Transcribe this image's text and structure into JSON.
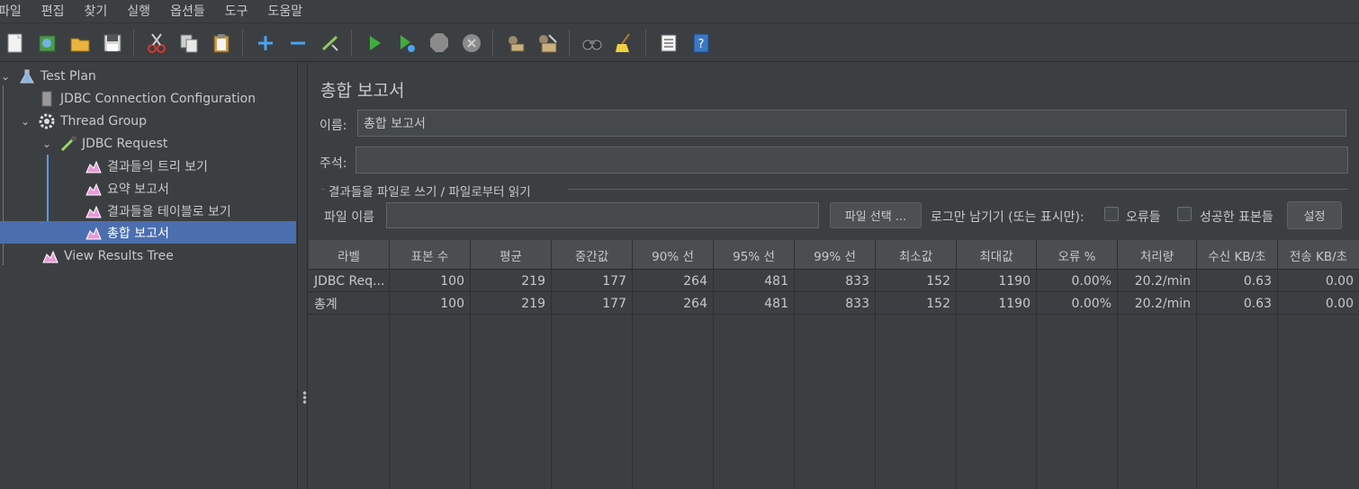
{
  "menu": [
    "파일",
    "편집",
    "찾기",
    "실행",
    "옵션들",
    "도구",
    "도움말"
  ],
  "toolbar": {
    "icons": [
      "new-icon",
      "templates-icon",
      "open-icon",
      "save-icon",
      "cut-icon",
      "copy-icon",
      "paste-icon",
      "expand-icon",
      "collapse-icon",
      "toggle-icon",
      "start-icon",
      "start-no-pause-icon",
      "stop-icon",
      "shutdown-icon",
      "clear-icon",
      "clear-all-icon",
      "search-icon",
      "reset-search-icon",
      "function-helper-icon",
      "help-icon"
    ]
  },
  "tree": {
    "items": [
      {
        "label": "Test Plan"
      },
      {
        "label": "JDBC Connection Configuration"
      },
      {
        "label": "Thread Group"
      },
      {
        "label": "JDBC Request"
      },
      {
        "label": "결과들의 트리 보기"
      },
      {
        "label": "요약 보고서"
      },
      {
        "label": "결과들을 테이블로 보기"
      },
      {
        "label": "총합 보고서"
      },
      {
        "label": "View Results Tree"
      }
    ]
  },
  "panel": {
    "title": "총합 보고서",
    "name_label": "이름:",
    "name_value": "총합 보고서",
    "comment_label": "주석:",
    "comment_value": "",
    "file_group_label": "결과들을 파일로 쓰기 / 파일로부터 읽기",
    "filename_label": "파일 이름",
    "filename_value": "",
    "browse_button": "파일 선택 ...",
    "log_only_label": "로그만 남기기 (또는 표시만):",
    "errors_label": "오류들",
    "successes_label": "성공한 표본들",
    "configure_button": "설정"
  },
  "table": {
    "headers": [
      "라벨",
      "표본 수",
      "평균",
      "중간값",
      "90% 선",
      "95% 선",
      "99% 선",
      "최소값",
      "최대값",
      "오류 %",
      "처리량",
      "수신 KB/초",
      "전송 KB/초"
    ],
    "rows": [
      [
        "JDBC Req...",
        "100",
        "219",
        "177",
        "264",
        "481",
        "833",
        "152",
        "1190",
        "0.00%",
        "20.2/min",
        "0.63",
        "0.00"
      ],
      [
        "총계",
        "100",
        "219",
        "177",
        "264",
        "481",
        "833",
        "152",
        "1190",
        "0.00%",
        "20.2/min",
        "0.63",
        "0.00"
      ]
    ]
  },
  "colors": {
    "background": "#3c3f41",
    "selection": "#4b6eaf",
    "tree_line": "#5a9be6"
  }
}
